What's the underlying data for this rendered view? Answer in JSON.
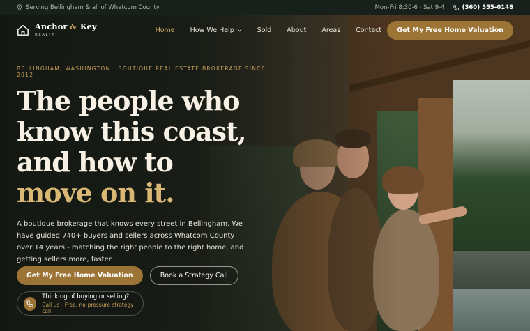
{
  "topbar": {
    "location_text": "Serving Bellingham & all of Whatcom County",
    "hours": "Mon-Fri 8:30-6 · Sat 9-4",
    "phone": "(360) 555-0148",
    "icons": {
      "location": "map-pin-icon",
      "phone": "phone-icon"
    }
  },
  "logo": {
    "name_part1": "Anchor",
    "amp": "&",
    "name_part2": "Key",
    "sub": "REALTY",
    "icon": "house-icon"
  },
  "nav": {
    "items": [
      {
        "label": "Home",
        "active": true
      },
      {
        "label": "How We Help",
        "dropdown": true
      },
      {
        "label": "Sold"
      },
      {
        "label": "About"
      },
      {
        "label": "Areas"
      },
      {
        "label": "Contact"
      }
    ],
    "cta": "Get My Free Home Valuation"
  },
  "hero": {
    "eyebrow": "BELLINGHAM, WASHINGTON · BOUTIQUE REAL ESTATE BROKERAGE SINCE 2012",
    "headline_lines": [
      "The people who",
      "know this coast,",
      "and how to"
    ],
    "headline_accent": "move on it.",
    "lead": "A boutique brokerage that knows every street in Bellingham. We have guided 740+ buyers and sellers across Whatcom County over 14 years - matching the right people to the right home, and getting sellers more, faster.",
    "primary_button": "Get My Free Home Valuation",
    "secondary_button": "Book a Strategy Call",
    "call_card": {
      "title": "Thinking of buying or selling?",
      "subtitle": "Call us - Free, no-pressure strategy call."
    }
  },
  "colors": {
    "accent_gold": "#9c7436",
    "headline_gold": "#d8b874",
    "background_dark": "#1c1f19"
  }
}
